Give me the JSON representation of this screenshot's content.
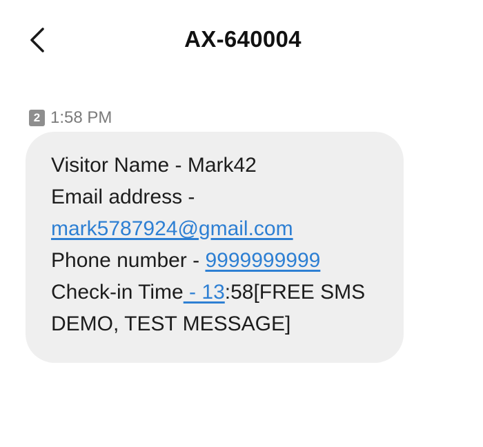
{
  "header": {
    "back_icon": "chevron-left-icon",
    "title": "AX-640004"
  },
  "message": {
    "sim_slot": "2",
    "time": "1:58 PM",
    "visitor_label": "Visitor Name - Mark42",
    "email_label": "Email address -",
    "email_link": "mark5787924@gmail.com",
    "phone_label": "Phone number - ",
    "phone_link": "9999999999",
    "checkin_label": "Check-in Time",
    "checkin_link": " - 13",
    "checkin_rest": ":58[FREE SMS",
    "last_line": "DEMO, TEST MESSAGE]"
  },
  "colors": {
    "link": "#2d7fd3",
    "bubble_bg": "#efefef",
    "sim_badge": "#8e8e8e"
  }
}
